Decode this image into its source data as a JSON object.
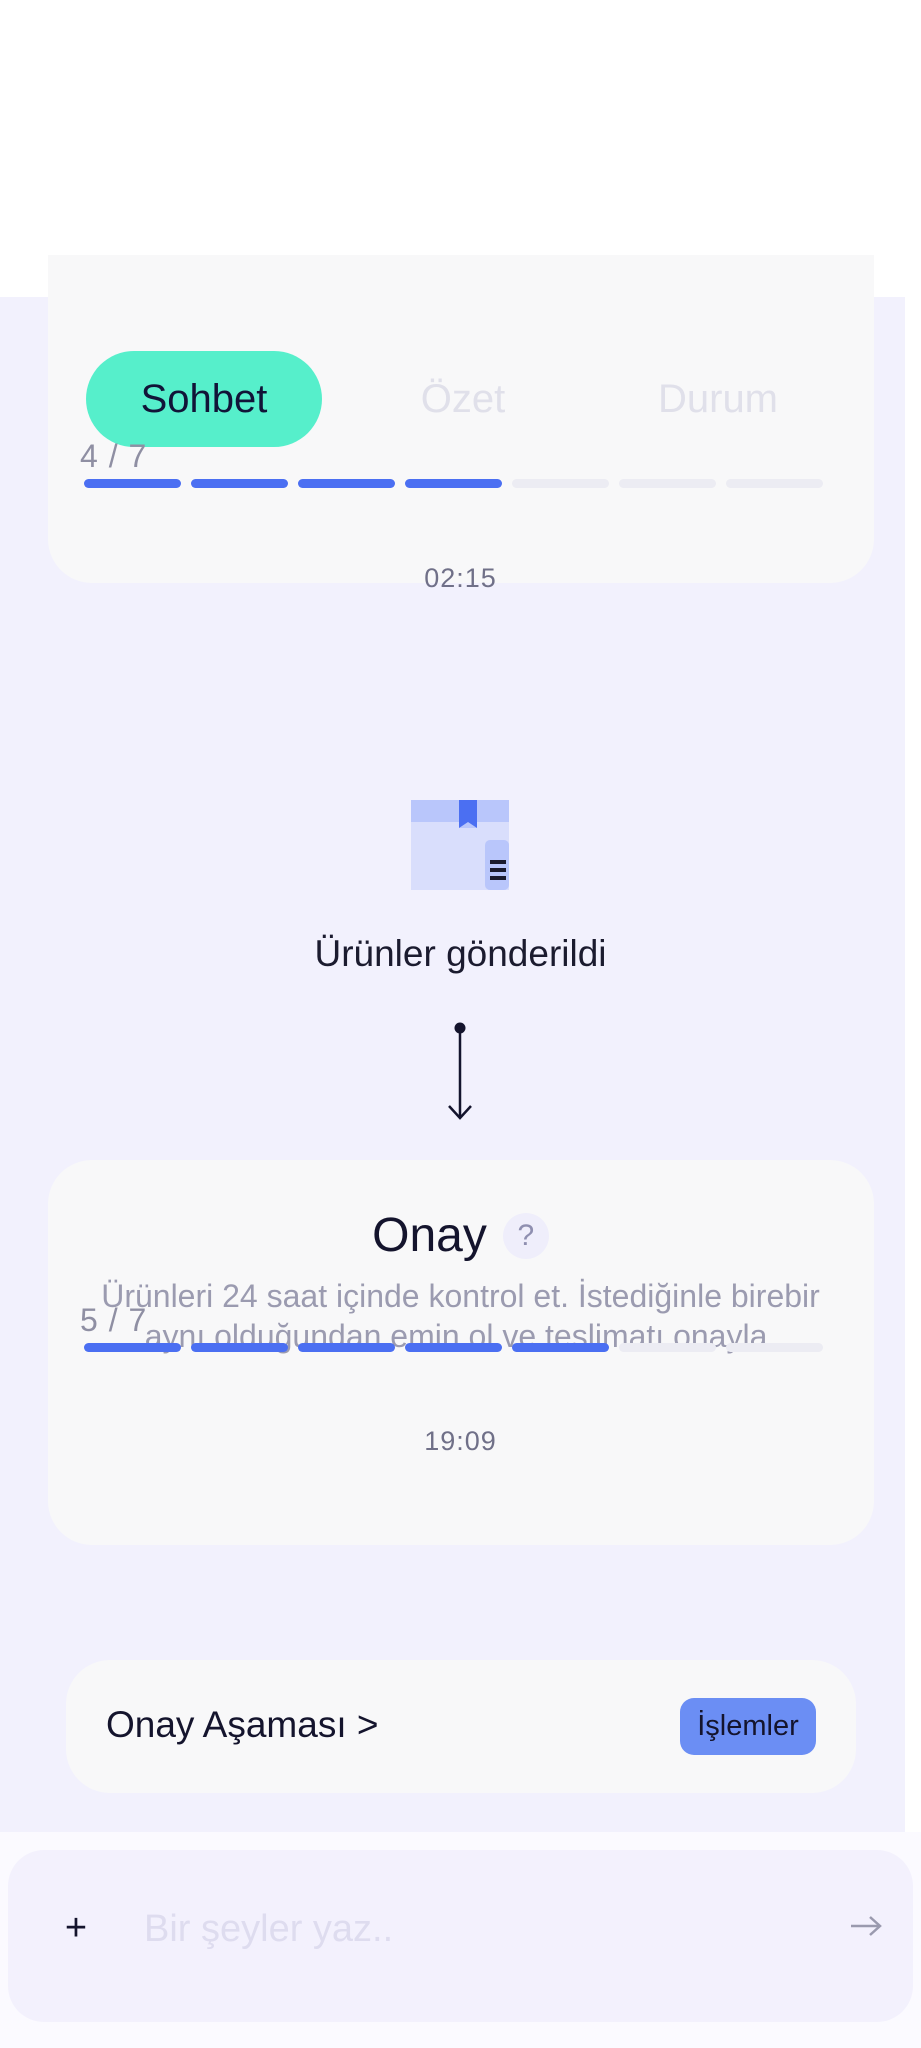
{
  "tabs": [
    {
      "label": "Sohbet",
      "active": true
    },
    {
      "label": "Özet",
      "active": false
    },
    {
      "label": "Durum",
      "active": false
    }
  ],
  "progress_top": {
    "label": "4 / 7",
    "current": 4,
    "total": 7
  },
  "timestamp_1": "02:15",
  "event": {
    "title": "Ürünler gönderildi",
    "icon": "package-box-icon"
  },
  "onay_card": {
    "title": "Onay",
    "help_label": "?",
    "description": "Ürünleri 24 saat içinde kontrol et. İstediğinle birebir aynı olduğundan emin ol ve teslimatı onayla.",
    "progress": {
      "label": "5 / 7",
      "current": 5,
      "total": 7
    }
  },
  "timestamp_2": "19:09",
  "stage_row": {
    "label": "Onay Aşaması >",
    "button_label": "İşlemler"
  },
  "composer": {
    "plus_label": "+",
    "placeholder": "Bir şeyler yaz.."
  },
  "colors": {
    "accent": "#56efcb",
    "progress_active": "#4b6ff2",
    "button": "#6b8ef4",
    "background": "#f2f1fd"
  }
}
